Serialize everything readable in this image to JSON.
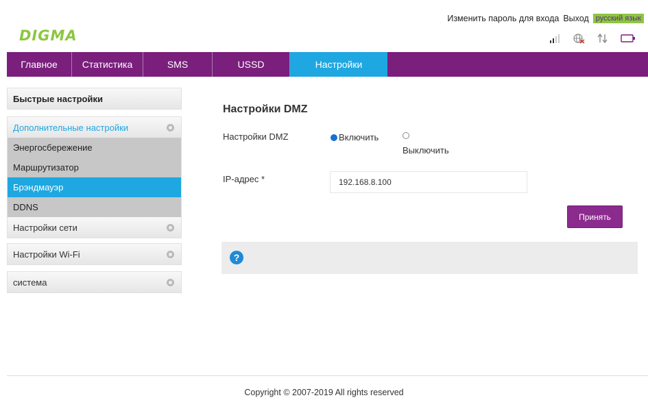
{
  "header": {
    "change_password": "Изменить пароль для входа",
    "logout": "Выход",
    "language": "русский язык",
    "logo": "DIGMA",
    "icons": [
      "signal-icon",
      "globe-icon",
      "data-transfer-icon",
      "battery-icon"
    ]
  },
  "nav": {
    "tabs": [
      {
        "label": "Главное"
      },
      {
        "label": "Статистика"
      },
      {
        "label": "SMS"
      },
      {
        "label": "USSD"
      },
      {
        "label": "Настройки"
      }
    ],
    "active": "Настройки"
  },
  "sidebar": {
    "quick": "Быстрые настройки",
    "advanced": {
      "label": "Дополнительные настройки",
      "items": [
        {
          "label": "Энергосбережение"
        },
        {
          "label": "Маршрутизатор"
        },
        {
          "label": "Брэндмауэр"
        },
        {
          "label": "DDNS"
        }
      ]
    },
    "network": "Настройки сети",
    "wifi": "Настройки Wi-Fi",
    "system": "система"
  },
  "main": {
    "title": "Настройки DMZ",
    "dmz_label": "Настройки DMZ",
    "enable_label": "Включить",
    "disable_label": "Выключить",
    "ip_label": "IP-адрес *",
    "ip_value": "192.168.8.100",
    "apply_label": "Принять",
    "help_icon": "?"
  },
  "footer": {
    "copyright": "Copyright © 2007-2019 All rights reserved"
  },
  "colors": {
    "nav_bg": "#7a1f7c",
    "accent_blue": "#1ea7e1",
    "logo_green": "#8dc63f",
    "button_purple": "#8b2b8e"
  }
}
